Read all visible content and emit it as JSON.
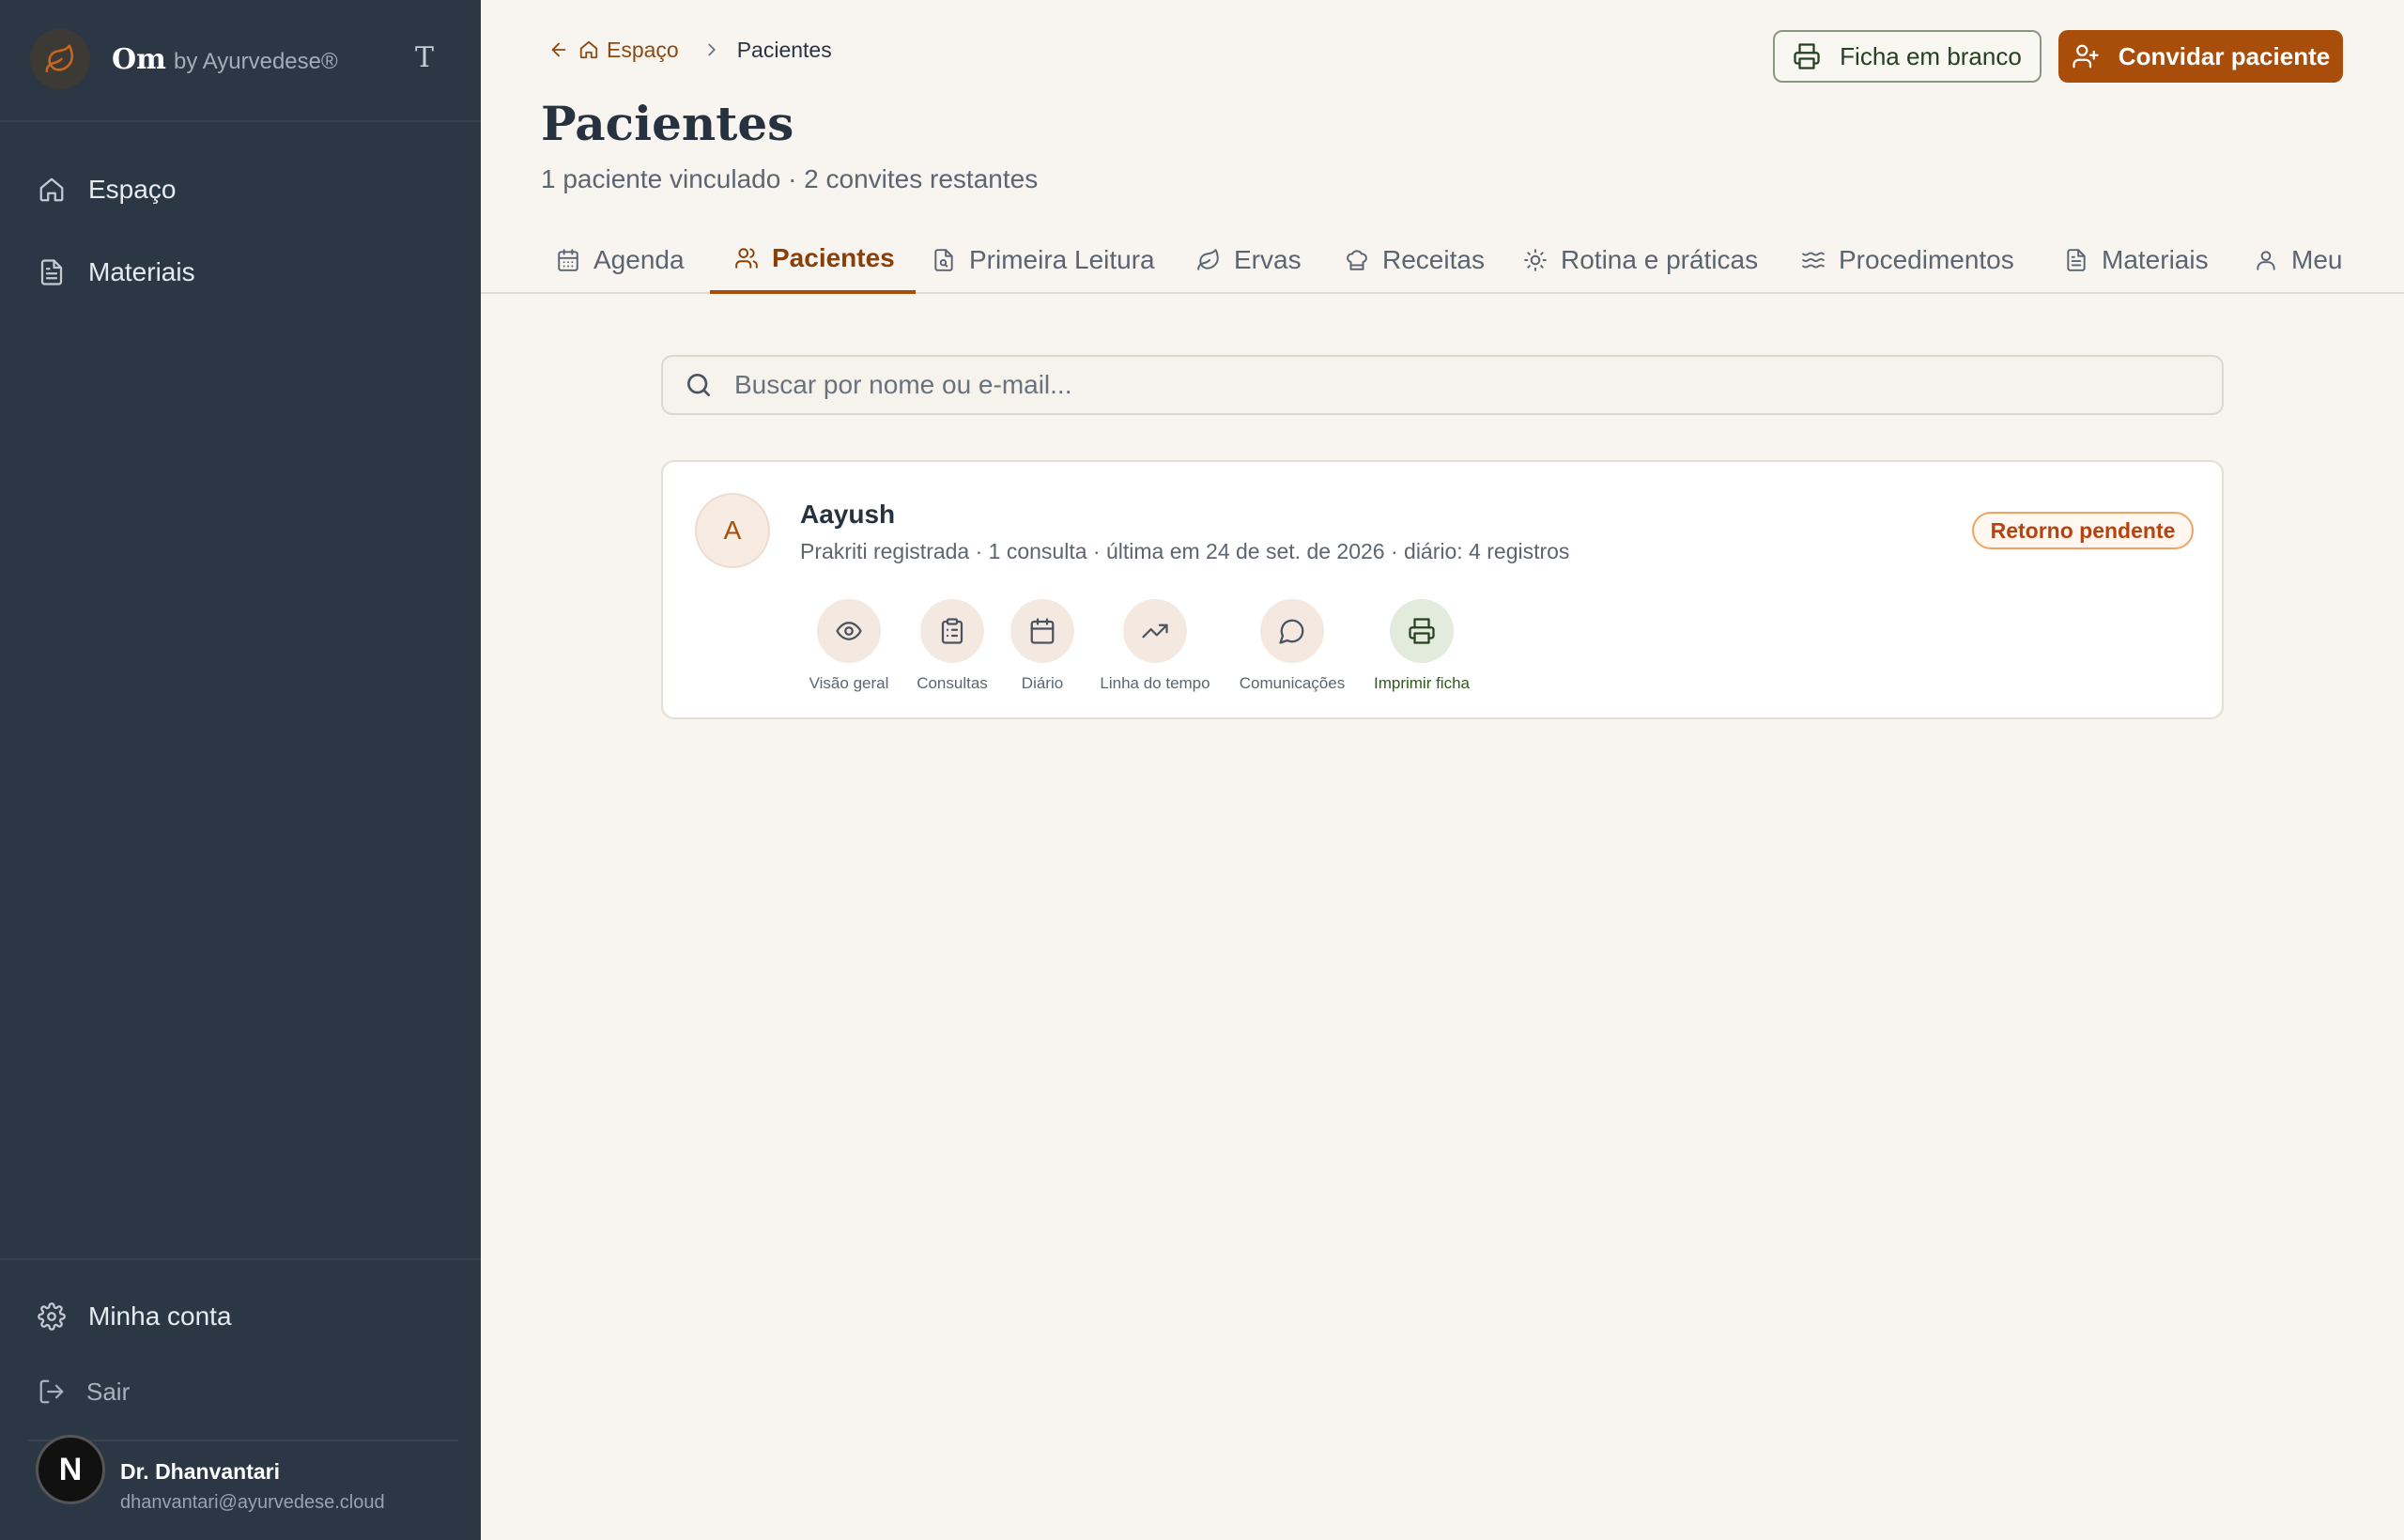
{
  "sidebar": {
    "brand_name": "Om",
    "brand_by": "by Ayurvedese®",
    "brand_toggle": "T",
    "nav": [
      {
        "label": "Espaço",
        "icon": "home-icon"
      },
      {
        "label": "Materiais",
        "icon": "document-icon"
      }
    ],
    "account_label": "Minha conta",
    "logout_label": "Sair",
    "user": {
      "initial": "N",
      "name": "Dr. Dhanvantari",
      "email": "dhanvantari@ayurvedese.cloud"
    }
  },
  "breadcrumb": {
    "back_label": "Espaço",
    "current": "Pacientes"
  },
  "header": {
    "blank_form_label": "Ficha em branco",
    "invite_label": "Convidar paciente",
    "title": "Pacientes",
    "subtitle": "1 paciente vinculado · 2 convites restantes"
  },
  "tabs": [
    {
      "label": "Agenda",
      "icon": "calendar-icon"
    },
    {
      "label": "Pacientes",
      "icon": "users-icon",
      "active": true
    },
    {
      "label": "Primeira Leitura",
      "icon": "document-search-icon"
    },
    {
      "label": "Ervas",
      "icon": "leaf-icon"
    },
    {
      "label": "Receitas",
      "icon": "chef-hat-icon"
    },
    {
      "label": "Rotina e práticas",
      "icon": "sun-icon"
    },
    {
      "label": "Procedimentos",
      "icon": "waves-icon"
    },
    {
      "label": "Materiais",
      "icon": "document-icon"
    },
    {
      "label": "Meu",
      "icon": "user-icon"
    }
  ],
  "search": {
    "placeholder": "Buscar por nome ou e-mail..."
  },
  "patients": [
    {
      "initial": "A",
      "name": "Aayush",
      "meta": "Prakriti registrada · 1 consulta · última em 24 de set. de 2026 · diário: 4 registros",
      "badge": "Retorno pendente",
      "actions": [
        {
          "label": "Visão geral",
          "icon": "eye-icon"
        },
        {
          "label": "Consultas",
          "icon": "clipboard-icon"
        },
        {
          "label": "Diário",
          "icon": "calendar-icon"
        },
        {
          "label": "Linha do tempo",
          "icon": "trend-icon"
        },
        {
          "label": "Comunicações",
          "icon": "chat-icon"
        },
        {
          "label": "Imprimir ficha",
          "icon": "printer-icon"
        }
      ]
    }
  ],
  "colors": {
    "sidebar_bg": "#2b3745",
    "accent": "#a84e0a",
    "page_bg": "#f8f5f0",
    "badge_text": "#b6420d",
    "print_green": "#2f5a1e"
  }
}
